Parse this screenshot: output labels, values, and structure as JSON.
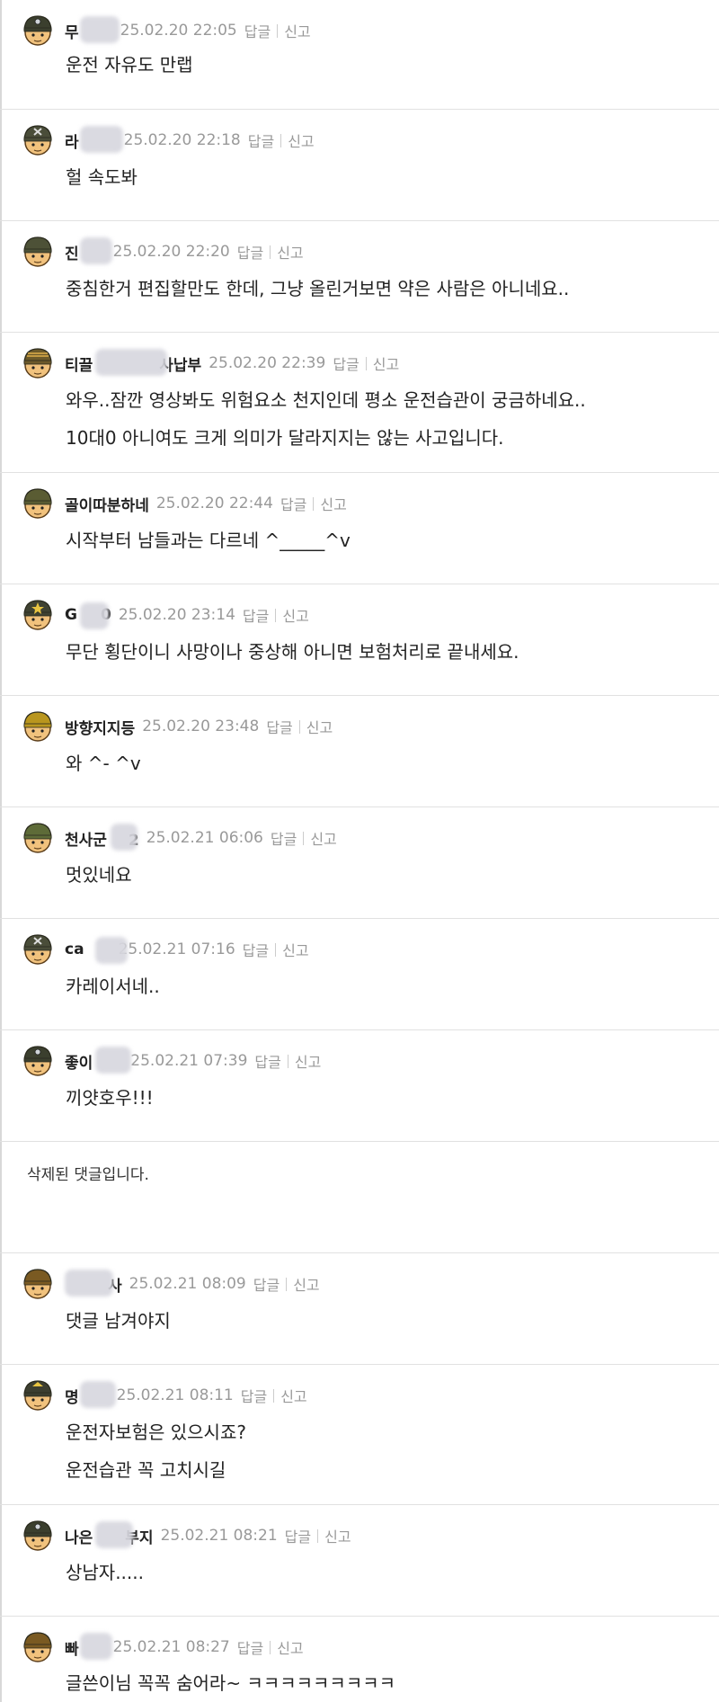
{
  "comments": [
    {
      "author": "무",
      "blur": true,
      "date": "25.02.20 22:05",
      "reply": "답글",
      "report": "신고",
      "lines": [
        "운전 자유도 만랩"
      ]
    },
    {
      "author": "라",
      "blur": true,
      "date": "25.02.20 22:18",
      "reply": "답글",
      "report": "신고",
      "lines": [
        "헐 속도봐"
      ]
    },
    {
      "author": "진",
      "blur": true,
      "date": "25.02.20 22:20",
      "reply": "답글",
      "report": "신고",
      "lines": [
        "중침한거 편집할만도 한데, 그냥 올린거보면 약은 사람은 아니네요.."
      ]
    },
    {
      "author": "티끌",
      "blur": true,
      "author_tail": "사납부",
      "date": "25.02.20 22:39",
      "reply": "답글",
      "report": "신고",
      "lines": [
        "와우..잠깐 영상봐도 위험요소 천지인데 평소 운전습관이 궁금하네요..",
        "10대0 아니여도 크게 의미가 달라지지는 않는 사고입니다."
      ]
    },
    {
      "author": "골이따분하네",
      "blur": false,
      "date": "25.02.20 22:44",
      "reply": "답글",
      "report": "신고",
      "lines": [
        "시작부터 남들과는 다르네 ^_____^v"
      ]
    },
    {
      "author": "G",
      "blur": true,
      "author_tail": "0",
      "date": "25.02.20 23:14",
      "reply": "답글",
      "report": "신고",
      "lines": [
        "무단 횡단이니 사망이나 중상해 아니면 보험처리로 끝내세요."
      ]
    },
    {
      "author": "방향지지등",
      "blur": false,
      "date": "25.02.20 23:48",
      "reply": "답글",
      "report": "신고",
      "lines": [
        "와 ^- ^v"
      ]
    },
    {
      "author": "천사군",
      "blur": true,
      "author_tail": "2",
      "date": "25.02.21 06:06",
      "reply": "답글",
      "report": "신고",
      "lines": [
        "멋있네요"
      ]
    },
    {
      "author": "ca",
      "blur": true,
      "date": "25.02.21 07:16",
      "reply": "답글",
      "report": "신고",
      "lines": [
        "카레이서네.."
      ]
    },
    {
      "author": "좋이",
      "blur": true,
      "date": "25.02.21 07:39",
      "reply": "답글",
      "report": "신고",
      "lines": [
        "끼얏호우!!!"
      ]
    },
    {
      "deleted": true,
      "text": "삭제된 댓글입니다."
    },
    {
      "author": "",
      "blur": true,
      "author_tail": "사",
      "date": "25.02.21 08:09",
      "reply": "답글",
      "report": "신고",
      "lines": [
        "댓글 남겨야지"
      ]
    },
    {
      "author": "명",
      "blur": true,
      "date": "25.02.21 08:11",
      "reply": "답글",
      "report": "신고",
      "lines": [
        "운전자보험은 있으시죠?",
        "운전습관 꼭 고치시길"
      ]
    },
    {
      "author": "나은",
      "blur": true,
      "author_tail": "부지",
      "date": "25.02.21 08:21",
      "reply": "답글",
      "report": "신고",
      "lines": [
        "상남자....."
      ]
    },
    {
      "author": "빠",
      "blur": true,
      "date": "25.02.21 08:27",
      "reply": "답글",
      "report": "신고",
      "lines": [
        "글쓴이님 꼭꼭 숨어라~ ㅋㅋㅋㅋㅋㅋㅋㅋㅋ"
      ]
    }
  ],
  "colors": {
    "meta": "#999999",
    "divider": "#e1e1e1",
    "text": "#222222"
  },
  "avatar_variants": [
    "helmet-goggles",
    "helmet-x",
    "helmet-round",
    "helmet-stripe",
    "helmet-olive",
    "helmet-star",
    "helmet-gold",
    "helmet-green",
    "helmet-x",
    "helmet-goggles",
    "",
    "helmet-plain",
    "helmet-crest",
    "helmet-goggles",
    "helmet-plain"
  ]
}
